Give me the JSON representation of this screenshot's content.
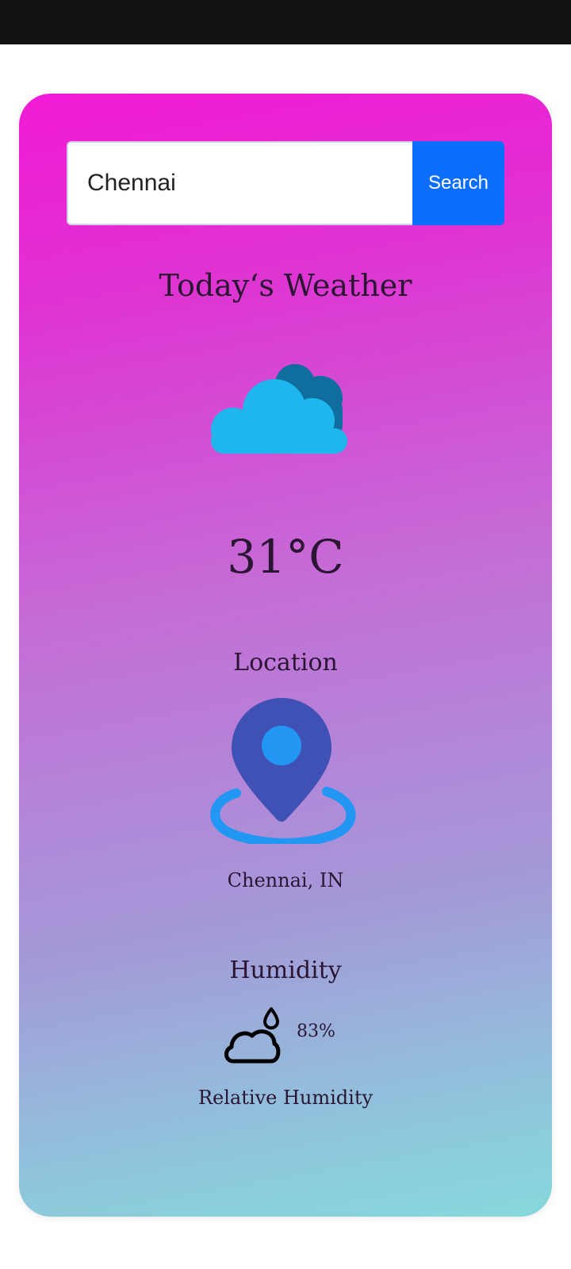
{
  "search": {
    "input_value": "Chennai",
    "button_label": "Search"
  },
  "weather": {
    "title": "Today‘s Weather",
    "condition_icon": "cloud-icon",
    "temperature": "31°C"
  },
  "location": {
    "title": "Location",
    "icon": "location-pin-icon",
    "name": "Chennai, IN"
  },
  "humidity": {
    "title": "Humidity",
    "icon": "humidity-cloud-drop-icon",
    "value": "83%",
    "label": "Relative Humidity"
  },
  "colors": {
    "search_button": "#0d6efd",
    "cloud_front": "#1eb6ec",
    "cloud_back": "#0f6e9e",
    "pin_body": "#3f51b5",
    "pin_accent": "#2196f3"
  }
}
